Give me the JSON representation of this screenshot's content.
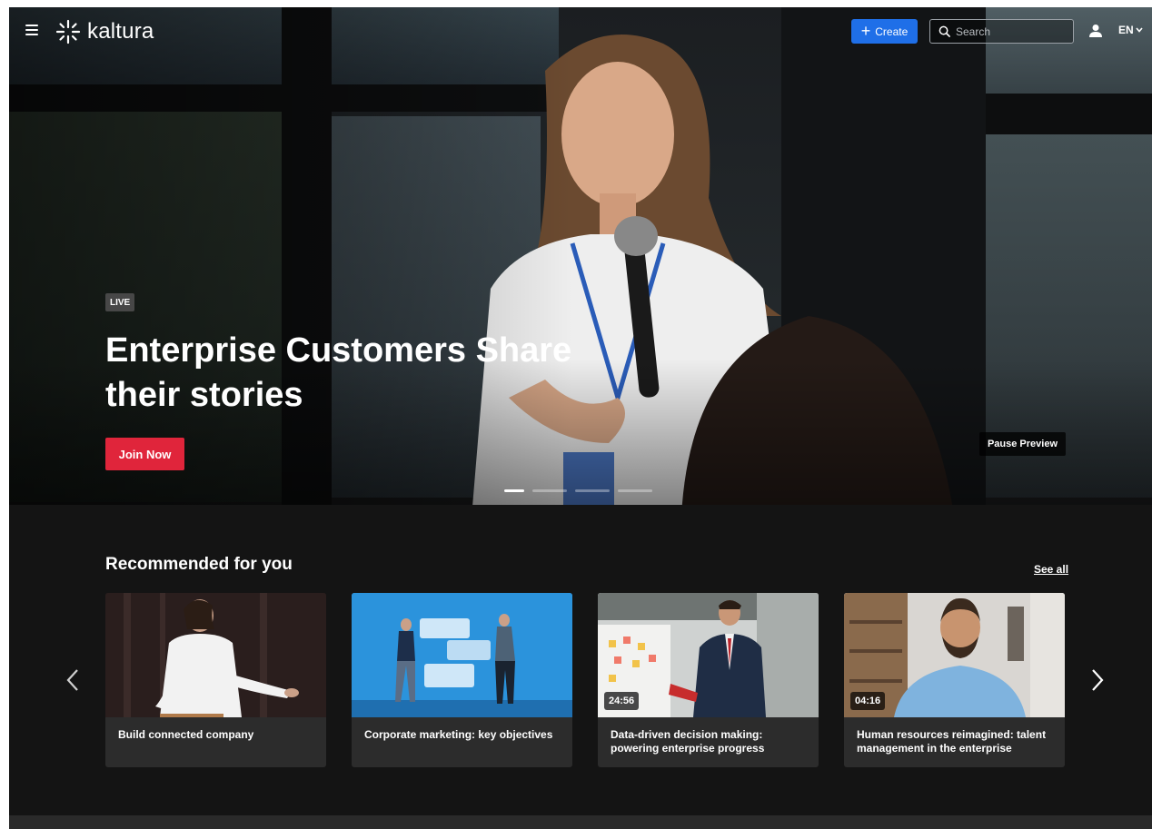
{
  "brand": {
    "name": "kaltura"
  },
  "header": {
    "create_label": "Create",
    "search_placeholder": "Search",
    "language": "EN"
  },
  "hero": {
    "badge": "LIVE",
    "title_line1": "Enterprise Customers Share",
    "title_line2": "their stories",
    "cta_label": "Join Now",
    "pause_label": "Pause Preview",
    "slides_count": 4,
    "active_slide": 1
  },
  "recommended": {
    "title": "Recommended for you",
    "see_all": "See all",
    "cards": [
      {
        "title": "Build connected company",
        "duration": ""
      },
      {
        "title": "Corporate marketing: key objectives",
        "duration": ""
      },
      {
        "title": "Data-driven decision making: powering enterprise progress",
        "duration": "24:56"
      },
      {
        "title": "Human resources reimagined: talent management in the enterprise",
        "duration": "04:16"
      }
    ]
  },
  "colors": {
    "create_button": "#1f6fe8",
    "join_button": "#e0253b",
    "page_background": "#141414",
    "card_background": "#2c2c2c"
  },
  "icons": [
    "menu-icon",
    "kaltura-logo-icon",
    "plus-icon",
    "search-icon",
    "user-icon",
    "chevron-down-icon",
    "chevron-left-icon",
    "chevron-right-icon"
  ]
}
